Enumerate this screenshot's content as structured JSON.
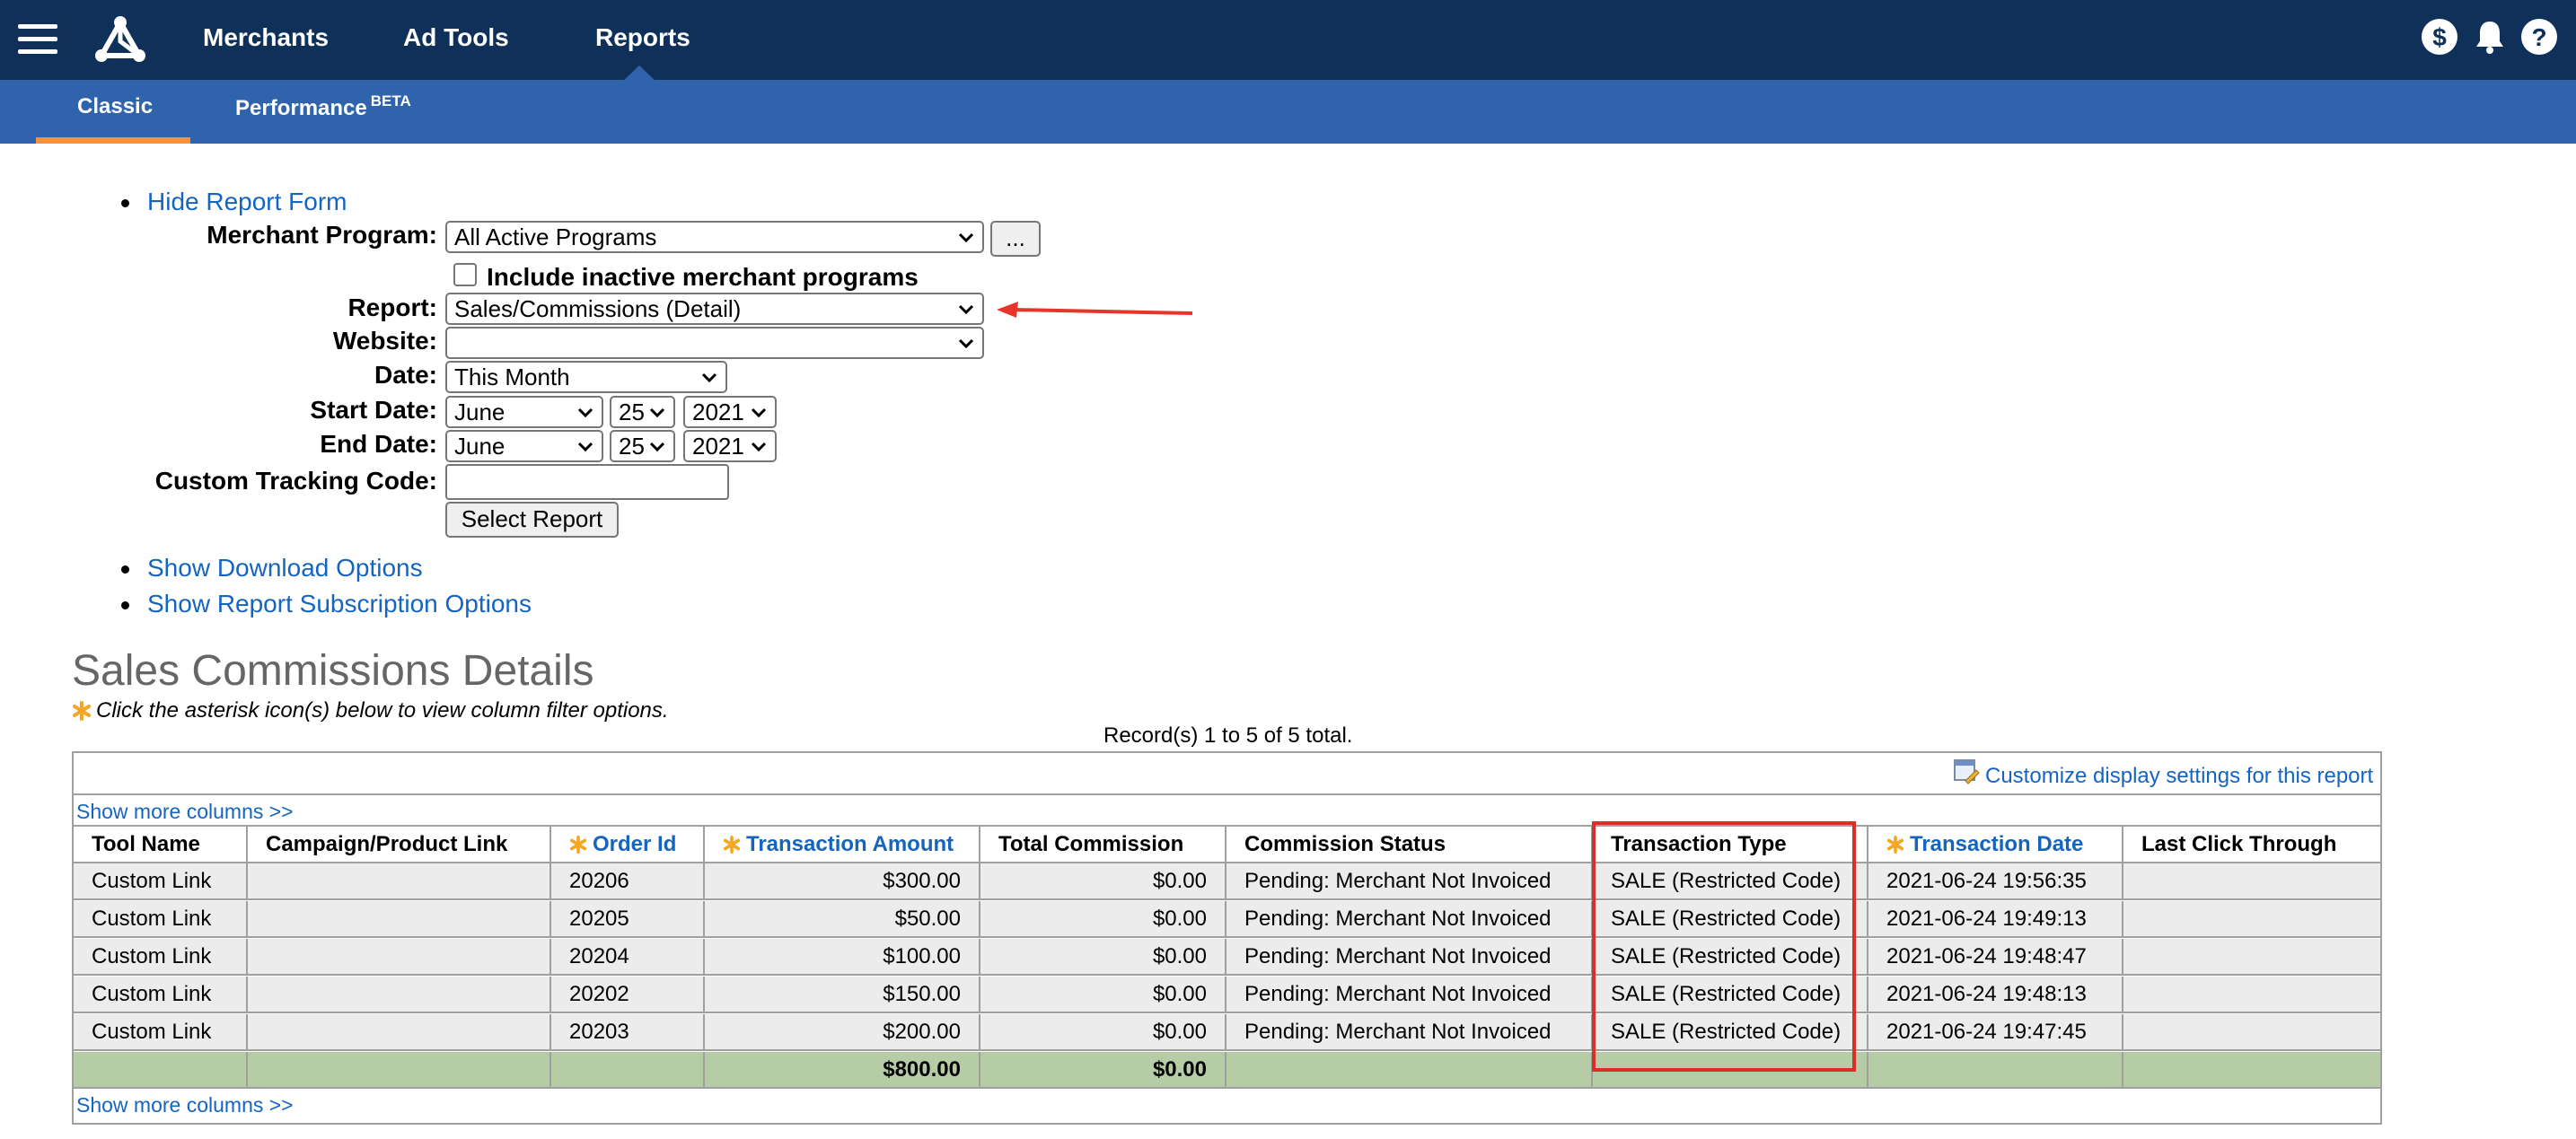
{
  "nav": {
    "items": [
      "Merchants",
      "Ad Tools",
      "Reports"
    ],
    "active": "Reports",
    "icons": [
      "dollar-icon",
      "bell-icon",
      "help-icon"
    ]
  },
  "subnav": {
    "tabs": [
      {
        "label": "Classic",
        "active": true
      },
      {
        "label": "Performance",
        "badge": "BETA",
        "active": false
      }
    ]
  },
  "form": {
    "hide_link": "Hide Report Form",
    "merchant_program_label": "Merchant Program:",
    "merchant_program_value": "All Active Programs",
    "more_button": "...",
    "include_inactive_label": "Include inactive merchant programs",
    "include_inactive_checked": false,
    "report_label": "Report:",
    "report_value": "Sales/Commissions (Detail)",
    "website_label": "Website:",
    "website_value": "",
    "date_label": "Date:",
    "date_value": "This Month",
    "start_date_label": "Start Date:",
    "start_month": "June",
    "start_day": "25",
    "start_year": "2021",
    "end_date_label": "End Date:",
    "end_month": "June",
    "end_day": "25",
    "end_year": "2021",
    "tracking_label": "Custom Tracking Code:",
    "tracking_value": "",
    "submit_label": "Select Report",
    "download_link": "Show Download Options",
    "subscription_link": "Show Report Subscription Options"
  },
  "report": {
    "title": "Sales Commissions Details",
    "hint": "Click the asterisk icon(s) below to view column filter options.",
    "records": "Record(s) 1 to 5 of 5 total.",
    "customize_link": "Customize display settings for this report",
    "show_more": "Show more columns >>",
    "columns": [
      "Tool Name",
      "Campaign/Product Link",
      "Order Id",
      "Transaction Amount",
      "Total Commission",
      "Commission Status",
      "Transaction Type",
      "Transaction Date",
      "Last Click Through"
    ],
    "rows": [
      [
        "Custom Link",
        "",
        "20206",
        "$300.00",
        "$0.00",
        "Pending: Merchant Not Invoiced",
        "SALE (Restricted Code)",
        "2021-06-24 19:56:35",
        ""
      ],
      [
        "Custom Link",
        "",
        "20205",
        "$50.00",
        "$0.00",
        "Pending: Merchant Not Invoiced",
        "SALE (Restricted Code)",
        "2021-06-24 19:49:13",
        ""
      ],
      [
        "Custom Link",
        "",
        "20204",
        "$100.00",
        "$0.00",
        "Pending: Merchant Not Invoiced",
        "SALE (Restricted Code)",
        "2021-06-24 19:48:47",
        ""
      ],
      [
        "Custom Link",
        "",
        "20202",
        "$150.00",
        "$0.00",
        "Pending: Merchant Not Invoiced",
        "SALE (Restricted Code)",
        "2021-06-24 19:48:13",
        ""
      ],
      [
        "Custom Link",
        "",
        "20203",
        "$200.00",
        "$0.00",
        "Pending: Merchant Not Invoiced",
        "SALE (Restricted Code)",
        "2021-06-24 19:47:45",
        ""
      ]
    ],
    "totals": [
      "",
      "",
      "",
      "$800.00",
      "$0.00",
      "",
      "",
      "",
      ""
    ]
  },
  "colors": {
    "topbar": "#0f3059",
    "subnav": "#2f64ac",
    "active_tab_underline": "#f5923e",
    "link": "#1565c0",
    "total_row": "#b5cca6",
    "highlight_box": "#d93025",
    "annotation_arrow": "#e8352b"
  }
}
